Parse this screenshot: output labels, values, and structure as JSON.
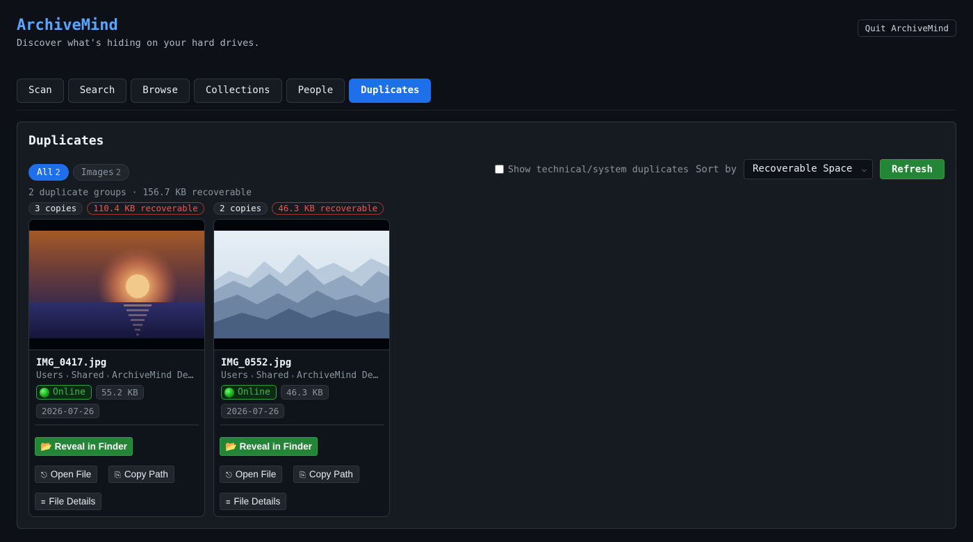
{
  "app": {
    "title": "ArchiveMind",
    "tagline": "Discover what's hiding on your hard drives.",
    "quit_label": "Quit ArchiveMind"
  },
  "tabs": [
    {
      "label": "Scan",
      "active": false
    },
    {
      "label": "Search",
      "active": false
    },
    {
      "label": "Browse",
      "active": false
    },
    {
      "label": "Collections",
      "active": false
    },
    {
      "label": "People",
      "active": false
    },
    {
      "label": "Duplicates",
      "active": true
    }
  ],
  "panel": {
    "title": "Duplicates",
    "filters": [
      {
        "label": "All",
        "count": "2",
        "active": true
      },
      {
        "label": "Images",
        "count": "2",
        "active": false
      }
    ],
    "show_system_label": "Show technical/system duplicates",
    "show_system_checked": false,
    "sort_label": "Sort by",
    "sort_value": "Recoverable Space",
    "refresh_label": "Refresh",
    "summary": "2 duplicate groups · 156.7 KB recoverable"
  },
  "groups": [
    {
      "copies": "3 copies",
      "recoverable": "110.4 KB recoverable",
      "file": {
        "name": "IMG_0417.jpg",
        "path": [
          "Users",
          "Shared",
          "ArchiveMind De…"
        ],
        "status": "Online",
        "size": "55.2 KB",
        "date": "2026-07-26",
        "thumbnail": "sunset-over-water"
      }
    },
    {
      "copies": "2 copies",
      "recoverable": "46.3 KB recoverable",
      "file": {
        "name": "IMG_0552.jpg",
        "path": [
          "Users",
          "Shared",
          "ArchiveMind De…"
        ],
        "status": "Online",
        "size": "46.3 KB",
        "date": "2026-07-26",
        "thumbnail": "mountain-ranges"
      }
    }
  ],
  "actions": {
    "reveal": "Reveal in Finder",
    "open": "Open File",
    "copy": "Copy Path",
    "details": "File Details"
  },
  "icons": {
    "reveal": "📂",
    "open": "⎋",
    "copy": "⎘",
    "details": "≡",
    "select_chevron": "⌵"
  },
  "colors": {
    "accent": "#1f6feb",
    "title": "#58a6ff",
    "success": "#238636",
    "danger": "#f85149"
  }
}
